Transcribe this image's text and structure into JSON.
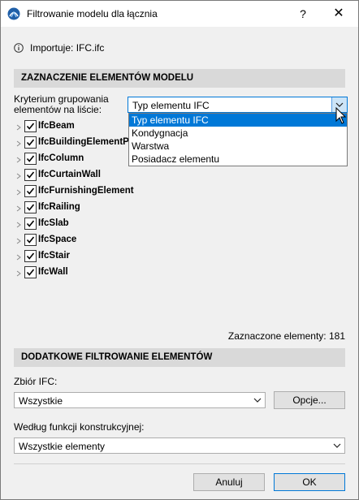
{
  "window": {
    "title": "Filtrowanie modelu dla łącznia",
    "help": "?",
    "close": "✕"
  },
  "info": {
    "text": "Importuje: IFC.ifc"
  },
  "selection_section": {
    "header": "ZAZNACZENIE ELEMENTÓW MODELU",
    "criterion_label": "Kryterium grupowania elementów na liście:",
    "criterion_value": "Typ elementu IFC",
    "dropdown_options": [
      "Typ elementu IFC",
      "Kondygnacja",
      "Warstwa",
      "Posiadacz elementu"
    ],
    "dropdown_selected_index": 0,
    "tree_items": [
      {
        "label": "IfcBeam",
        "checked": true
      },
      {
        "label": "IfcBuildingElementPr",
        "checked": true
      },
      {
        "label": "IfcColumn",
        "checked": true
      },
      {
        "label": "IfcCurtainWall",
        "checked": true
      },
      {
        "label": "IfcFurnishingElement",
        "checked": true
      },
      {
        "label": "IfcRailing",
        "checked": true
      },
      {
        "label": "IfcSlab",
        "checked": true
      },
      {
        "label": "IfcSpace",
        "checked": true
      },
      {
        "label": "IfcStair",
        "checked": true
      },
      {
        "label": "IfcWall",
        "checked": true
      }
    ],
    "selected_count_text": "Zaznaczone elementy: 181"
  },
  "additional_section": {
    "header": "DODATKOWE FILTROWANIE ELEMENTÓW",
    "ifc_set_label": "Zbiór IFC:",
    "ifc_set_value": "Wszystkie",
    "options_button": "Opcje...",
    "structural_label": "Według funkcji konstrukcyjnej:",
    "structural_value": "Wszystkie elementy"
  },
  "footer": {
    "cancel": "Anuluj",
    "ok": "OK"
  },
  "colors": {
    "accent": "#0078d7",
    "section_bg": "#d9d9d9",
    "panel_bg": "#f0f0f0"
  }
}
